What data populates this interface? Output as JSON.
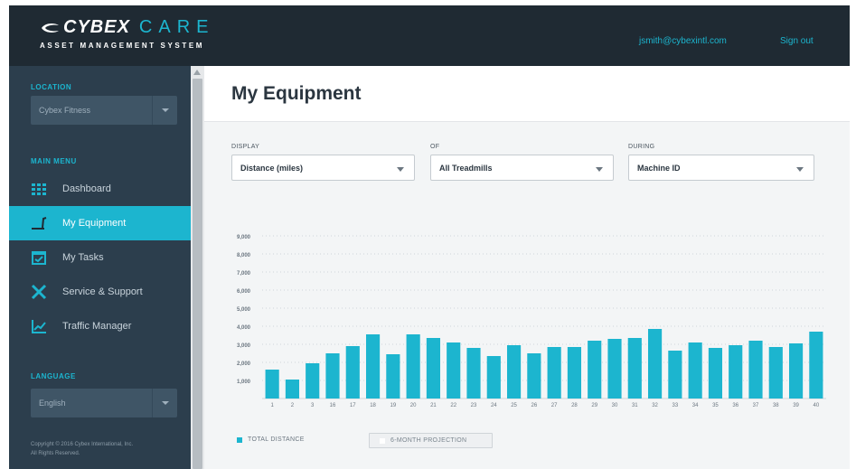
{
  "header": {
    "brand": "CYBEX",
    "product": "CARE",
    "subtitle": "ASSET MANAGEMENT SYSTEM",
    "user_email": "jsmith@cybexintl.com",
    "signout_label": "Sign out"
  },
  "sidebar": {
    "location_label": "LOCATION",
    "location_value": "Cybex Fitness",
    "menu_label": "MAIN MENU",
    "items": [
      {
        "label": "Dashboard",
        "icon": "grid-icon",
        "active": false
      },
      {
        "label": "My Equipment",
        "icon": "treadmill-icon",
        "active": true
      },
      {
        "label": "My Tasks",
        "icon": "calendar-check-icon",
        "active": false
      },
      {
        "label": "Service & Support",
        "icon": "tools-icon",
        "active": false
      },
      {
        "label": "Traffic Manager",
        "icon": "line-chart-icon",
        "active": false
      }
    ],
    "language_label": "LANGUAGE",
    "language_value": "English",
    "copyright_line1": "Copyright © 2016 Cybex International, Inc.",
    "copyright_line2": "All Rights Reserved."
  },
  "main": {
    "title": "My Equipment",
    "filters": [
      {
        "label": "DISPLAY",
        "value": "Distance (miles)"
      },
      {
        "label": "OF",
        "value": "All Treadmills"
      },
      {
        "label": "DURING",
        "value": "Machine ID"
      }
    ],
    "legend_total": "TOTAL DISTANCE",
    "legend_projection": "6-MONTH PROJECTION"
  },
  "colors": {
    "accent": "#1cb5cf",
    "header_bg": "#1f2a33",
    "sidebar_bg": "#2c3e4d"
  },
  "chart_data": {
    "type": "bar",
    "series": [
      {
        "name": "TOTAL DISTANCE"
      }
    ],
    "categories": [
      "1",
      "2",
      "3",
      "16",
      "17",
      "18",
      "19",
      "20",
      "21",
      "22",
      "23",
      "24",
      "25",
      "26",
      "27",
      "28",
      "29",
      "30",
      "31",
      "32",
      "33",
      "34",
      "35",
      "36",
      "37",
      "38",
      "39",
      "40"
    ],
    "values": [
      1600,
      1050,
      1950,
      2500,
      2900,
      3550,
      2450,
      3550,
      3350,
      3100,
      2800,
      2350,
      2950,
      2500,
      2850,
      2850,
      3200,
      3300,
      3350,
      3850,
      2650,
      3100,
      2800,
      2950,
      3200,
      2850,
      3050,
      3700
    ],
    "yticks": [
      "1,000",
      "2,000",
      "3,000",
      "4,000",
      "5,000",
      "6,000",
      "7,000",
      "8,000",
      "9,000"
    ],
    "ylim": [
      0,
      9000
    ],
    "grid": true
  }
}
